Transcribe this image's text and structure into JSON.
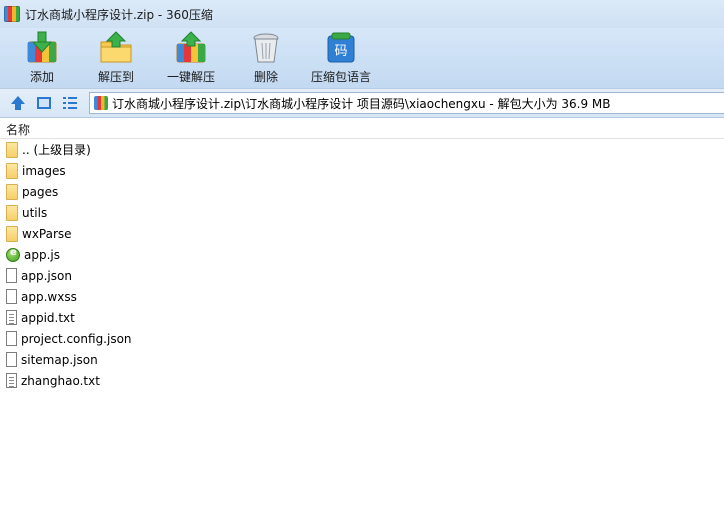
{
  "window": {
    "title": "订水商城小程序设计.zip - 360压缩",
    "app_icon": "archive-icon"
  },
  "toolbar": {
    "items": [
      {
        "label": "添加",
        "icon": "add-archive-icon"
      },
      {
        "label": "解压到",
        "icon": "extract-to-icon"
      },
      {
        "label": "一键解压",
        "icon": "one-click-extract-icon"
      },
      {
        "label": "删除",
        "icon": "delete-icon"
      },
      {
        "label": "压缩包语言",
        "icon": "archive-language-icon"
      }
    ]
  },
  "address": {
    "path": "订水商城小程序设计.zip\\订水商城小程序设计 项目源码\\xiaochengxu - 解包大小为 36.9 MB"
  },
  "list": {
    "header_name": "名称",
    "items": [
      {
        "name": ".. (上级目录)",
        "type": "folder"
      },
      {
        "name": "images",
        "type": "folder"
      },
      {
        "name": "pages",
        "type": "folder"
      },
      {
        "name": "utils",
        "type": "folder"
      },
      {
        "name": "wxParse",
        "type": "folder"
      },
      {
        "name": "app.js",
        "type": "js"
      },
      {
        "name": "app.json",
        "type": "file"
      },
      {
        "name": "app.wxss",
        "type": "file"
      },
      {
        "name": "appid.txt",
        "type": "text"
      },
      {
        "name": "project.config.json",
        "type": "file"
      },
      {
        "name": "sitemap.json",
        "type": "file"
      },
      {
        "name": "zhanghao.txt",
        "type": "text"
      }
    ]
  }
}
